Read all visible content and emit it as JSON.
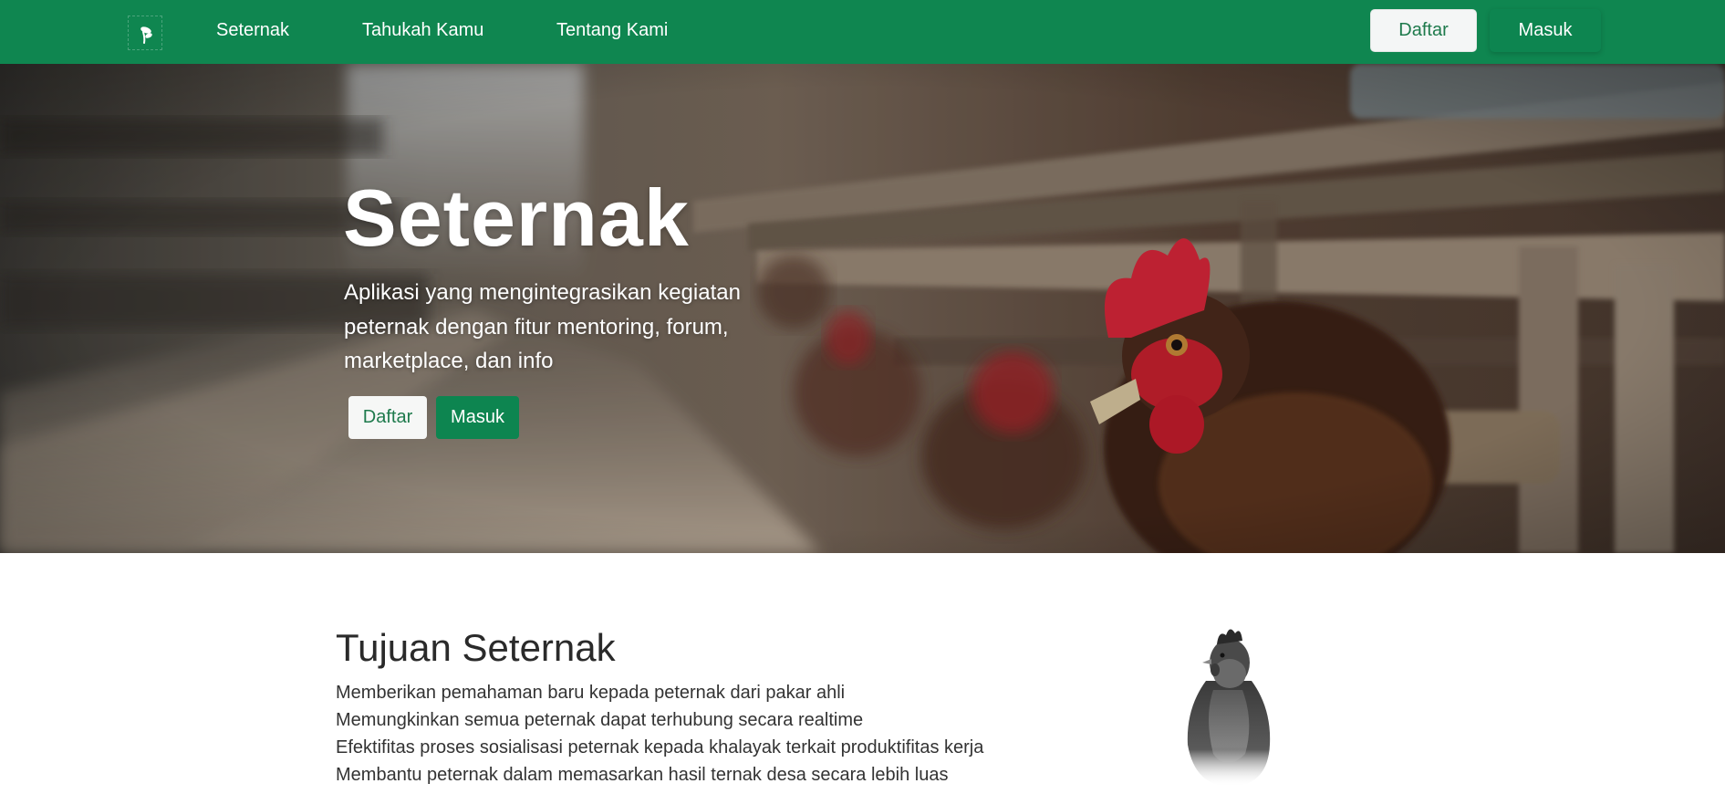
{
  "navbar": {
    "logo_icon": "seternak-logo-icon",
    "links": [
      {
        "label": "Seternak"
      },
      {
        "label": "Tahukah Kamu"
      },
      {
        "label": "Tentang Kami"
      }
    ],
    "daftar_label": "Daftar",
    "masuk_label": "Masuk",
    "bg_color": "#0f8650"
  },
  "hero": {
    "title": "Seternak",
    "subtitle": "Aplikasi yang mengintegrasikan kegiatan peternak dengan fitur mentoring, forum, marketplace, dan info",
    "daftar_label": "Daftar",
    "masuk_label": "Masuk",
    "background_image": "chickens-in-cage-photo"
  },
  "tujuan": {
    "title": "Tujuan Seternak",
    "items": [
      "Memberikan pemahaman baru kepada peternak dari pakar ahli",
      "Memungkinkan semua peternak dapat terhubung secara realtime",
      "Efektifitas proses sosialisasi peternak kepada khalayak terkait produktifitas kerja",
      "Membantu peternak dalam memasarkan hasil ternak desa secara lebih luas"
    ],
    "image": "hen-illustration"
  },
  "colors": {
    "primary_green": "#0d8550",
    "button_light": "#f4f6f6",
    "button_light_text": "#1e7a4c"
  }
}
